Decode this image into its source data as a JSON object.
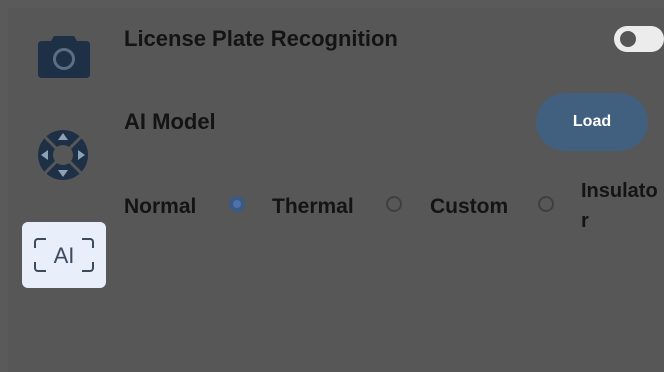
{
  "sidebar": {
    "items": [
      {
        "name": "camera",
        "icon": "camera-icon"
      },
      {
        "name": "gimbal",
        "icon": "gimbal-dpad-icon"
      },
      {
        "name": "ai",
        "icon": "ai-scan-icon",
        "label": "AI",
        "selected": true
      }
    ]
  },
  "settings": {
    "license_plate": {
      "label": "License Plate Recognition",
      "enabled": false
    },
    "ai_model": {
      "label": "AI Model",
      "load_button": "Load",
      "options": [
        {
          "label": "Normal",
          "selected": true
        },
        {
          "label": "Thermal",
          "selected": false
        },
        {
          "label": "Custom",
          "selected": false
        },
        {
          "label": "Insulator",
          "selected": false
        }
      ]
    }
  },
  "colors": {
    "background": "#575757",
    "accent": "#41607f",
    "selected_tab": "#e9eefb"
  }
}
